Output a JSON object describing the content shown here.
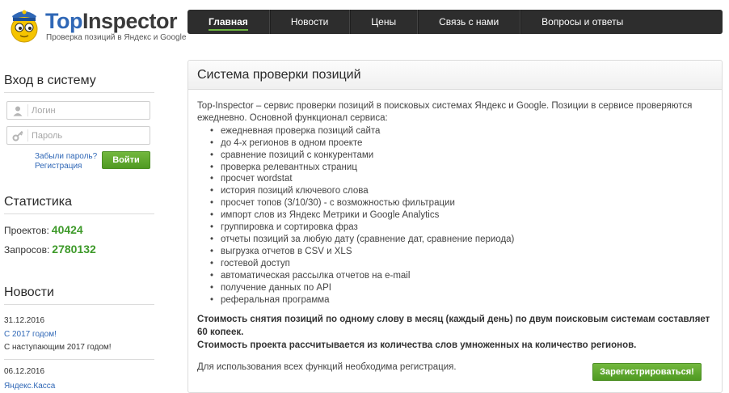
{
  "logo": {
    "title_part1": "Top",
    "title_part2": "Inspector",
    "subtitle": "Проверка позиций в Яндекс и Google"
  },
  "nav": {
    "items": [
      {
        "label": "Главная"
      },
      {
        "label": "Новости"
      },
      {
        "label": "Цены"
      },
      {
        "label": "Связь с нами"
      },
      {
        "label": "Вопросы и ответы"
      }
    ]
  },
  "login": {
    "title": "Вход в систему",
    "login_placeholder": "Логин",
    "password_placeholder": "Пароль",
    "forgot_link": "Забыли пароль?",
    "register_link": "Регистрация",
    "submit_label": "Войти"
  },
  "stats": {
    "title": "Статистика",
    "projects_label": "Проектов:",
    "projects_value": "40424",
    "queries_label": "Запросов:",
    "queries_value": "2780132"
  },
  "news": {
    "title": "Новости",
    "items": [
      {
        "date": "31.12.2016",
        "headline": "С 2017 годом!",
        "text": "С наступающим 2017 годом!"
      },
      {
        "date": "06.12.2016",
        "headline": "Яндекс.Касса"
      }
    ]
  },
  "main": {
    "title": "Система проверки позиций",
    "intro": "Top-Inspector – сервис проверки позиций в поисковых системах Яндекс и Google. Позиции в сервисе проверяются ежедневно. Основной функционал сервиса:",
    "features": [
      "ежедневная проверка позиций сайта",
      "до 4-х регионов в одном проекте",
      "сравнение позиций с конкурентами",
      "проверка релевантных страниц",
      "просчет wordstat",
      "история позиций ключевого слова",
      "просчет топов (3/10/30) - с возможностью фильтрации",
      "импорт слов из Яндекс Метрики и Google Analytics",
      "группировка и сортировка фраз",
      "отчеты позиций за любую дату (сравнение дат, сравнение периода)",
      "выгрузка отчетов в CSV и XLS",
      "гостевой доступ",
      "автоматическая рассылка отчетов на e-mail",
      "получение данных по API",
      "реферальная программа"
    ],
    "price_line1": "Стоимость снятия позиций по одному слову в месяц (каждый день) по двум поисковым системам составляет 60 копеек.",
    "price_line2": "Стоимость проекта рассчитывается из количества слов умноженных на количество регионов.",
    "registration_note": "Для использования всех функций необходима регистрация.",
    "register_button": "Зарегистрироваться!"
  },
  "colors": {
    "accent_green": "#4f9a22",
    "link_blue": "#2f67b6",
    "nav_bg": "#2d2d2d",
    "stat_green": "#3e9a2a"
  }
}
